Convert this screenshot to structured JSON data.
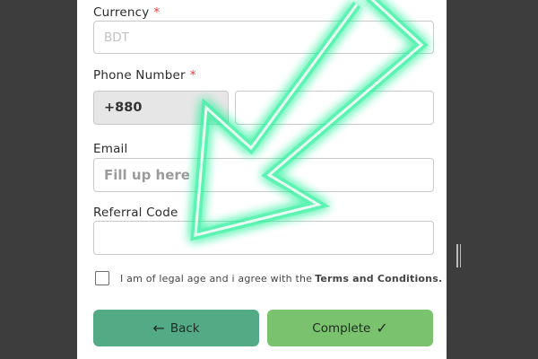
{
  "form": {
    "currency": {
      "label": "Currency",
      "required_mark": "*",
      "value": "BDT"
    },
    "phone": {
      "label": "Phone Number",
      "required_mark": "*",
      "prefix": "+880",
      "value": ""
    },
    "email": {
      "label": "Email",
      "placeholder": "Fill up here",
      "value": ""
    },
    "referral": {
      "label": "Referral Code",
      "value": ""
    },
    "agree": {
      "text": "I am of legal age and i agree with the",
      "link_text": "Terms and Conditions.",
      "checked": false
    }
  },
  "buttons": {
    "back_label": "Back",
    "back_icon": "arrow-left-icon",
    "complete_label": "Complete",
    "complete_icon": "checkmark-icon"
  },
  "colors": {
    "back_button": "#53ab85",
    "complete_button": "#7ac26d",
    "required_mark": "#e53935",
    "overlay_arrow": "#27f09a"
  },
  "overlay": {
    "icon": "neon-arrow-icon"
  }
}
